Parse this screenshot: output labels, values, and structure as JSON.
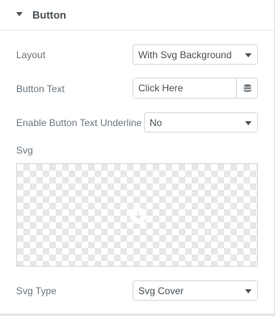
{
  "section": {
    "title": "Button",
    "icon": "caret-down-icon"
  },
  "layout": {
    "label": "Layout",
    "value": "With Svg Background"
  },
  "button_text": {
    "label": "Button Text",
    "value": "Click Here",
    "dynamic_icon": "database-icon"
  },
  "underline": {
    "label": "Enable Button Text Underline",
    "value": "No"
  },
  "svg": {
    "label": "Svg",
    "preview_icon": "upload-icon"
  },
  "svg_type": {
    "label": "Svg Type",
    "value": "Svg Cover"
  }
}
